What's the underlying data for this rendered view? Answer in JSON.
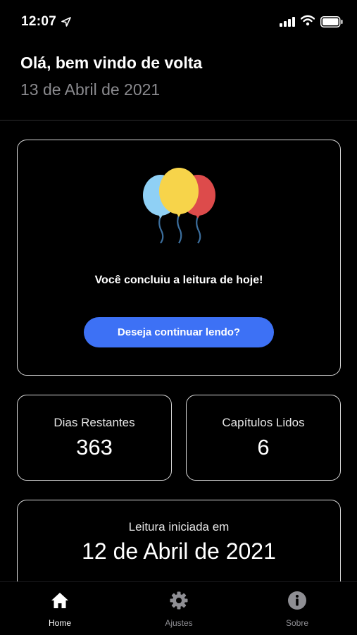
{
  "status_bar": {
    "time": "12:07",
    "icons": [
      "location-arrow-icon",
      "signal-icon",
      "wifi-icon",
      "battery-icon"
    ]
  },
  "header": {
    "greeting": "Olá, bem vindo de volta",
    "date": "13 de Abril de 2021"
  },
  "completion_card": {
    "icon": "balloons-icon",
    "message": "Você concluiu a leitura de hoje!",
    "button_label": "Deseja continuar lendo?"
  },
  "stats": {
    "days_remaining": {
      "label": "Dias Restantes",
      "value": "363"
    },
    "chapters_read": {
      "label": "Capítulos Lidos",
      "value": "6"
    }
  },
  "start_card": {
    "label": "Leitura iniciada em",
    "date": "12 de Abril de 2021"
  },
  "tab_bar": {
    "tabs": [
      {
        "label": "Home",
        "icon": "home-icon",
        "active": true
      },
      {
        "label": "Ajustes",
        "icon": "gear-icon",
        "active": false
      },
      {
        "label": "Sobre",
        "icon": "info-icon",
        "active": false
      }
    ]
  },
  "colors": {
    "background": "#000000",
    "accent_button": "#3d71f5",
    "card_border": "#d8d8d8",
    "muted_text": "#8a8a8e",
    "inactive_tab": "#8e8e93",
    "balloon_blue": "#8fd0f5",
    "balloon_yellow": "#f7d44a",
    "balloon_red": "#dd4b4b"
  }
}
